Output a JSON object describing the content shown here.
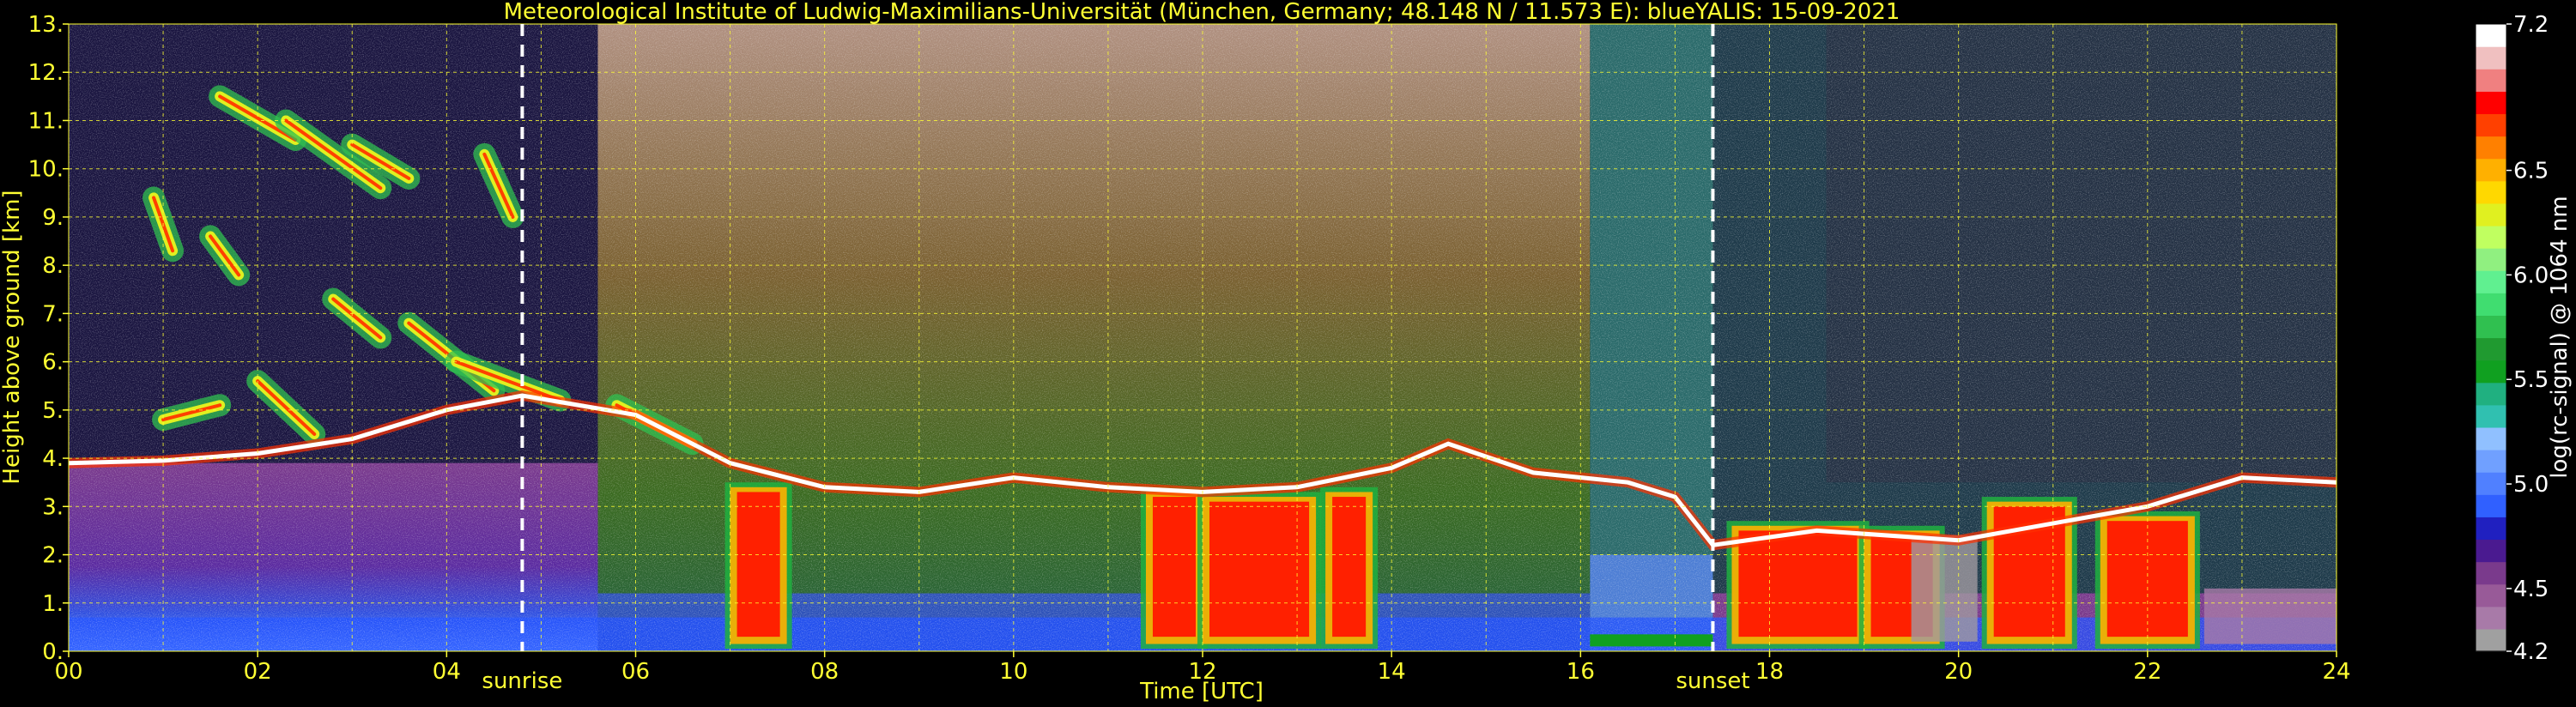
{
  "chart_data": {
    "type": "heatmap",
    "title": "Meteorological Institute of Ludwig-Maximilians-Universität (München, Germany; 48.148 N / 11.573 E):     blueYALIS: 15-09-2021",
    "xlabel": "Time [UTC]",
    "ylabel": "Height above ground [km]",
    "xlim": [
      0,
      24
    ],
    "ylim": [
      0,
      13
    ],
    "x_ticks": [
      "00",
      "02",
      "04",
      "06",
      "08",
      "10",
      "12",
      "14",
      "16",
      "18",
      "20",
      "22",
      "24"
    ],
    "y_ticks": [
      "0.",
      "1.",
      "2.",
      "3.",
      "4.",
      "5.",
      "6.",
      "7.",
      "8.",
      "9.",
      "10.",
      "11.",
      "12.",
      "13."
    ],
    "grid": true,
    "annotations": [
      {
        "label": "sunrise",
        "time_utc": 4.8
      },
      {
        "label": "sunset",
        "time_utc": 17.4
      }
    ],
    "colorbar": {
      "label": "log(rc-signal) @ 1064 nm",
      "range": [
        4.2,
        7.2
      ],
      "ticks": [
        "7.2",
        "6.5",
        "6.0",
        "5.5",
        "5.0",
        "4.5",
        "4.2"
      ],
      "colors": [
        "#a0a0a0",
        "#a87aa8",
        "#985a98",
        "#7a3a8c",
        "#4a1a90",
        "#2020c0",
        "#3060ff",
        "#5080ff",
        "#70a0ff",
        "#90c0ff",
        "#30c0b0",
        "#20b080",
        "#10a020",
        "#209a30",
        "#30c050",
        "#40dd70",
        "#60f090",
        "#90f080",
        "#c0ff60",
        "#e0f020",
        "#ffd800",
        "#ffb000",
        "#ff8000",
        "#ff4000",
        "#ff0000",
        "#f08080",
        "#f0c0c0",
        "#ffffff"
      ]
    },
    "cloud_layer_km": [
      {
        "t": 0.0,
        "h": 3.9
      },
      {
        "t": 1.0,
        "h": 3.95
      },
      {
        "t": 2.0,
        "h": 4.1
      },
      {
        "t": 3.0,
        "h": 4.4
      },
      {
        "t": 4.0,
        "h": 5.0
      },
      {
        "t": 4.8,
        "h": 5.3
      },
      {
        "t": 6.0,
        "h": 4.9
      },
      {
        "t": 7.0,
        "h": 3.9
      },
      {
        "t": 8.0,
        "h": 3.4
      },
      {
        "t": 9.0,
        "h": 3.3
      },
      {
        "t": 10.0,
        "h": 3.6
      },
      {
        "t": 11.0,
        "h": 3.4
      },
      {
        "t": 12.0,
        "h": 3.3
      },
      {
        "t": 13.0,
        "h": 3.4
      },
      {
        "t": 14.0,
        "h": 3.8
      },
      {
        "t": 14.6,
        "h": 4.3
      },
      {
        "t": 15.5,
        "h": 3.7
      },
      {
        "t": 16.5,
        "h": 3.5
      },
      {
        "t": 17.0,
        "h": 3.2
      },
      {
        "t": 17.4,
        "h": 2.2
      },
      {
        "t": 18.5,
        "h": 2.5
      },
      {
        "t": 20.0,
        "h": 2.3
      },
      {
        "t": 22.0,
        "h": 3.0
      },
      {
        "t": 23.0,
        "h": 3.6
      },
      {
        "t": 24.0,
        "h": 3.5
      }
    ]
  }
}
